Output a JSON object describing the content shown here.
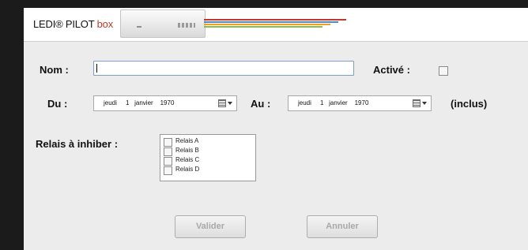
{
  "header": {
    "logo_text": "LEDI® PILOT",
    "logo_brand": "box",
    "accent_color": "#c0392b"
  },
  "form": {
    "nom_label": "Nom :",
    "nom_value": "",
    "active_label": "Activé :",
    "active_checked": false,
    "du_label": "Du :",
    "du_value": "jeudi     1   janvier    1970",
    "au_label": "Au :",
    "au_value": "jeudi     1   janvier    1970",
    "inclus_label": "(inclus)",
    "relais_label": "Relais à inhiber :",
    "relais": [
      {
        "label": "Relais A",
        "checked": false
      },
      {
        "label": "Relais B",
        "checked": false
      },
      {
        "label": "Relais C",
        "checked": false
      },
      {
        "label": "Relais D",
        "checked": false
      }
    ]
  },
  "buttons": {
    "valider": "Valider",
    "annuler": "Annuler"
  }
}
